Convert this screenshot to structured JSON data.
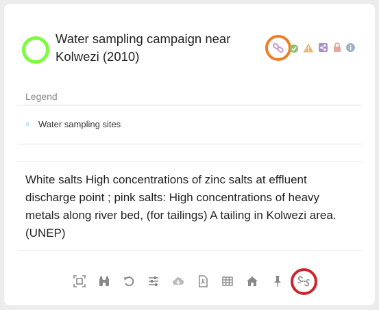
{
  "header": {
    "title": "Water sampling campaign near Kolwezi (2010)",
    "status_color": "#7cfc3c",
    "icons": [
      {
        "name": "link-icon",
        "color": "#c79ad0",
        "highlight": "#ef7d22"
      },
      {
        "name": "check-icon",
        "color": "#8fbf6f"
      },
      {
        "name": "warning-icon",
        "color": "#e6b77a"
      },
      {
        "name": "share-icon",
        "color": "#a991c8"
      },
      {
        "name": "lock-icon",
        "color": "#e2a7a0"
      },
      {
        "name": "info-icon",
        "color": "#9fb0c6"
      }
    ]
  },
  "legend": {
    "heading": "Legend",
    "items": [
      {
        "label": "Water sampling sites",
        "color": "#bfeef6"
      }
    ]
  },
  "description": "White salts High concentrations of zinc salts at effluent discharge point ; pink salts: High concentrations of heavy metals along river bed, (for tailings) A tailing in Kolwezi area. (UNEP)",
  "toolbar": {
    "icon_color": "#888888",
    "buttons": [
      "zoom-extent-icon",
      "binoculars-icon",
      "undo-icon",
      "sliders-icon",
      "cloud-download-icon",
      "pdf-file-icon",
      "table-icon",
      "home-icon",
      "pin-icon",
      "unlink-icon"
    ],
    "highlight": "#d0222d"
  }
}
